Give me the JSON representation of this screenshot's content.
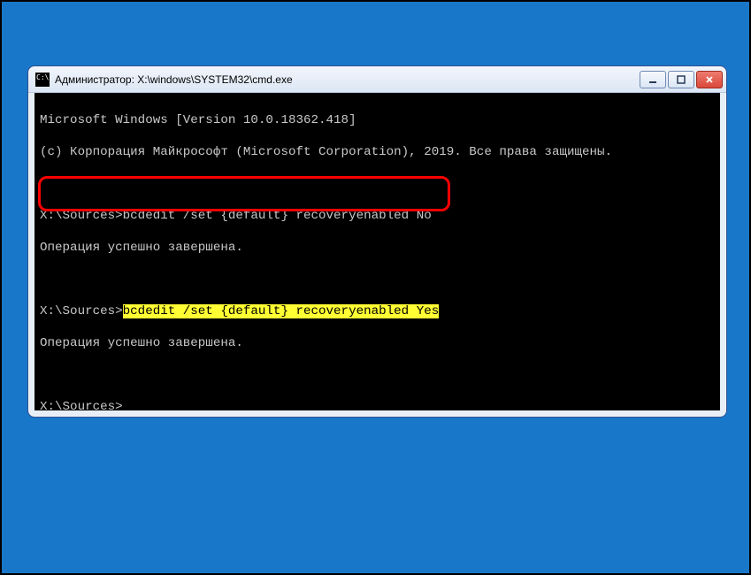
{
  "window": {
    "title": "Администратор: X:\\windows\\SYSTEM32\\cmd.exe"
  },
  "terminal": {
    "line_version": "Microsoft Windows [Version 10.0.18362.418]",
    "line_copyright": "(c) Корпорация Майкрософт (Microsoft Corporation), 2019. Все права защищены.",
    "prompt1": "X:\\Sources>",
    "cmd1": "bcdedit /set {default} recoveryenabled No",
    "result1": "Операция успешно завершена.",
    "prompt2": "X:\\Sources>",
    "cmd2": "bcdedit /set {default} recoveryenabled Yes",
    "result2": "Операция успешно завершена.",
    "prompt3": "X:\\Sources>"
  }
}
